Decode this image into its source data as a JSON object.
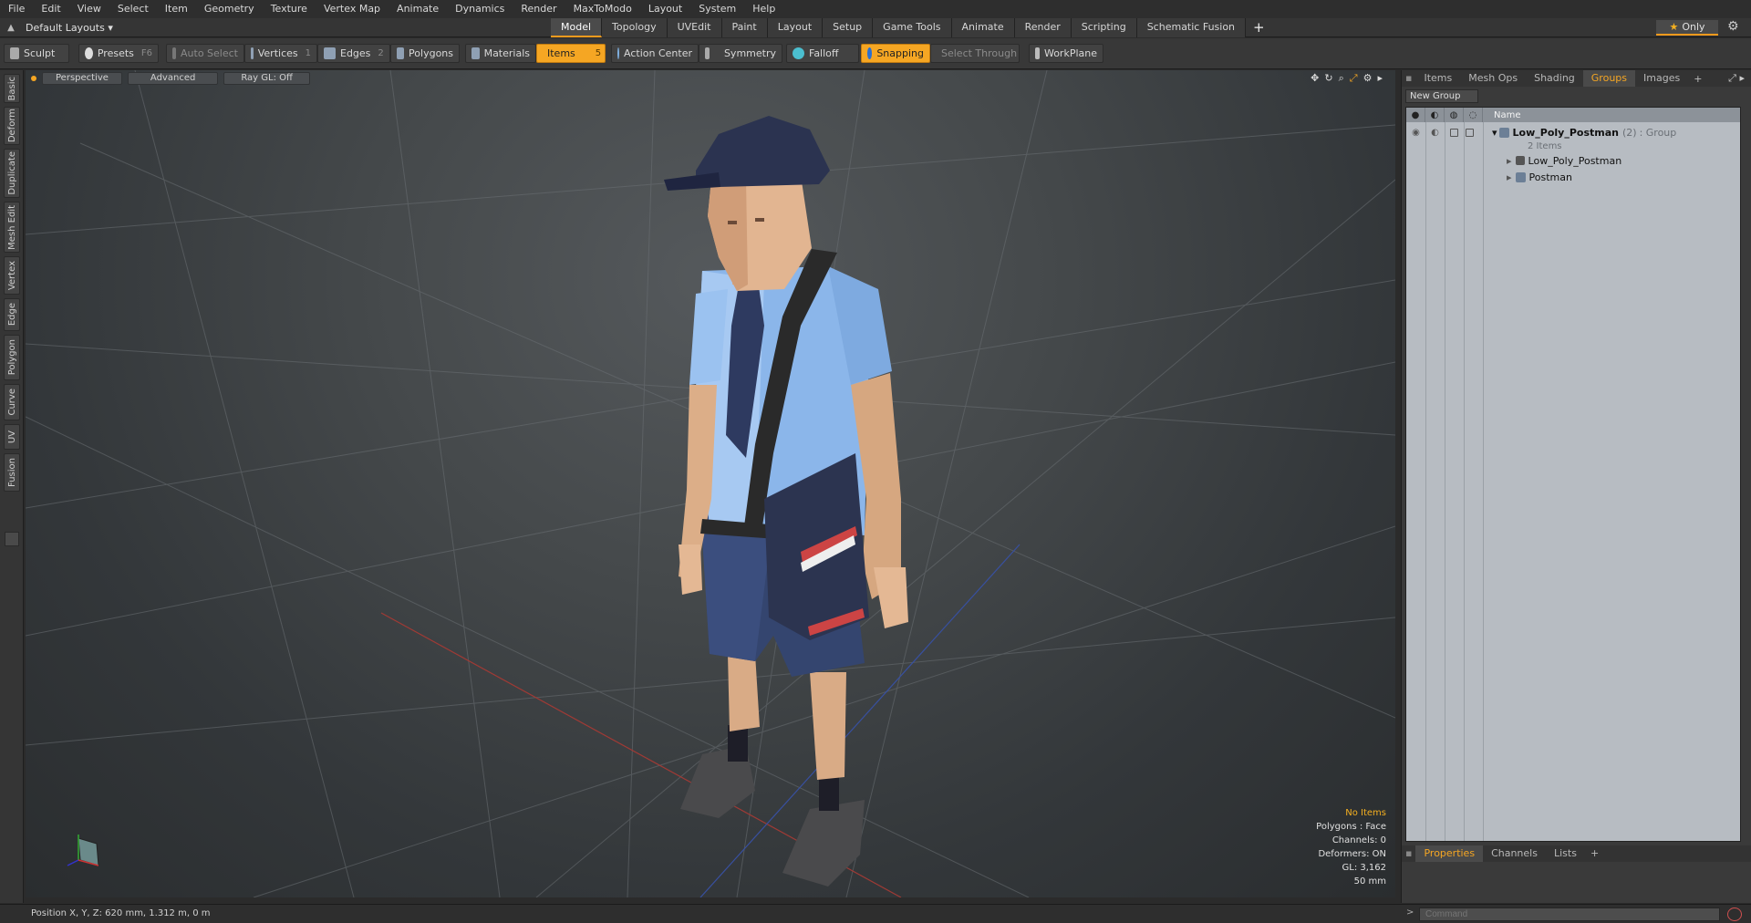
{
  "menubar": {
    "items": [
      "File",
      "Edit",
      "View",
      "Select",
      "Item",
      "Geometry",
      "Texture",
      "Vertex Map",
      "Animate",
      "Dynamics",
      "Render",
      "MaxToModo",
      "Layout",
      "System",
      "Help"
    ]
  },
  "layoutbar": {
    "layout_name": "Default Layouts",
    "tabs": [
      "Model",
      "Topology",
      "UVEdit",
      "Paint",
      "Layout",
      "Setup",
      "Game Tools",
      "Animate",
      "Render",
      "Scripting",
      "Schematic Fusion"
    ],
    "active_tab": "Model",
    "plus": "+",
    "only_label": "Only"
  },
  "toolbar": {
    "sculpt": "Sculpt",
    "presets": "Presets",
    "presets_key": "F6",
    "auto_select": "Auto Select",
    "vertices": "Vertices",
    "vertices_key": "1",
    "edges": "Edges",
    "edges_key": "2",
    "polygons": "Polygons",
    "materials": "Materials",
    "items": "Items",
    "items_key": "5",
    "action_center": "Action Center",
    "symmetry": "Symmetry",
    "falloff": "Falloff",
    "snapping": "Snapping",
    "select_through": "Select Through",
    "workplane": "WorkPlane"
  },
  "left_tabs": [
    "Basic",
    "Deform",
    "Duplicate",
    "Mesh Edit",
    "Vertex",
    "Edge",
    "Polygon",
    "Curve",
    "UV",
    "Fusion"
  ],
  "viewport": {
    "view_mode": "Perspective",
    "shading": "Advanced",
    "raygl": "Ray GL: Off",
    "info": {
      "selection": "No Items",
      "polygons": "Polygons : Face",
      "channels": "Channels: 0",
      "deformers": "Deformers: ON",
      "gl": "GL: 3,162",
      "focal": "50 mm"
    }
  },
  "right_panel": {
    "tabs": [
      "Items",
      "Mesh Ops",
      "Shading",
      "Groups",
      "Images"
    ],
    "active_tab": "Groups",
    "new_group": "New Group",
    "name_header": "Name",
    "group": {
      "name": "Low_Poly_Postman",
      "count": "(2)",
      "type": ": Group",
      "sub": "2 Items",
      "children": [
        "Low_Poly_Postman",
        "Postman"
      ]
    },
    "bottom_tabs": [
      "Properties",
      "Channels",
      "Lists"
    ]
  },
  "statusbar": {
    "position": "Position X, Y, Z:   620 mm, 1.312 m, 0 m"
  },
  "command": {
    "placeholder": "Command"
  },
  "colors": {
    "accent": "#f5a623",
    "groups_bg": "#b7bcc2"
  }
}
